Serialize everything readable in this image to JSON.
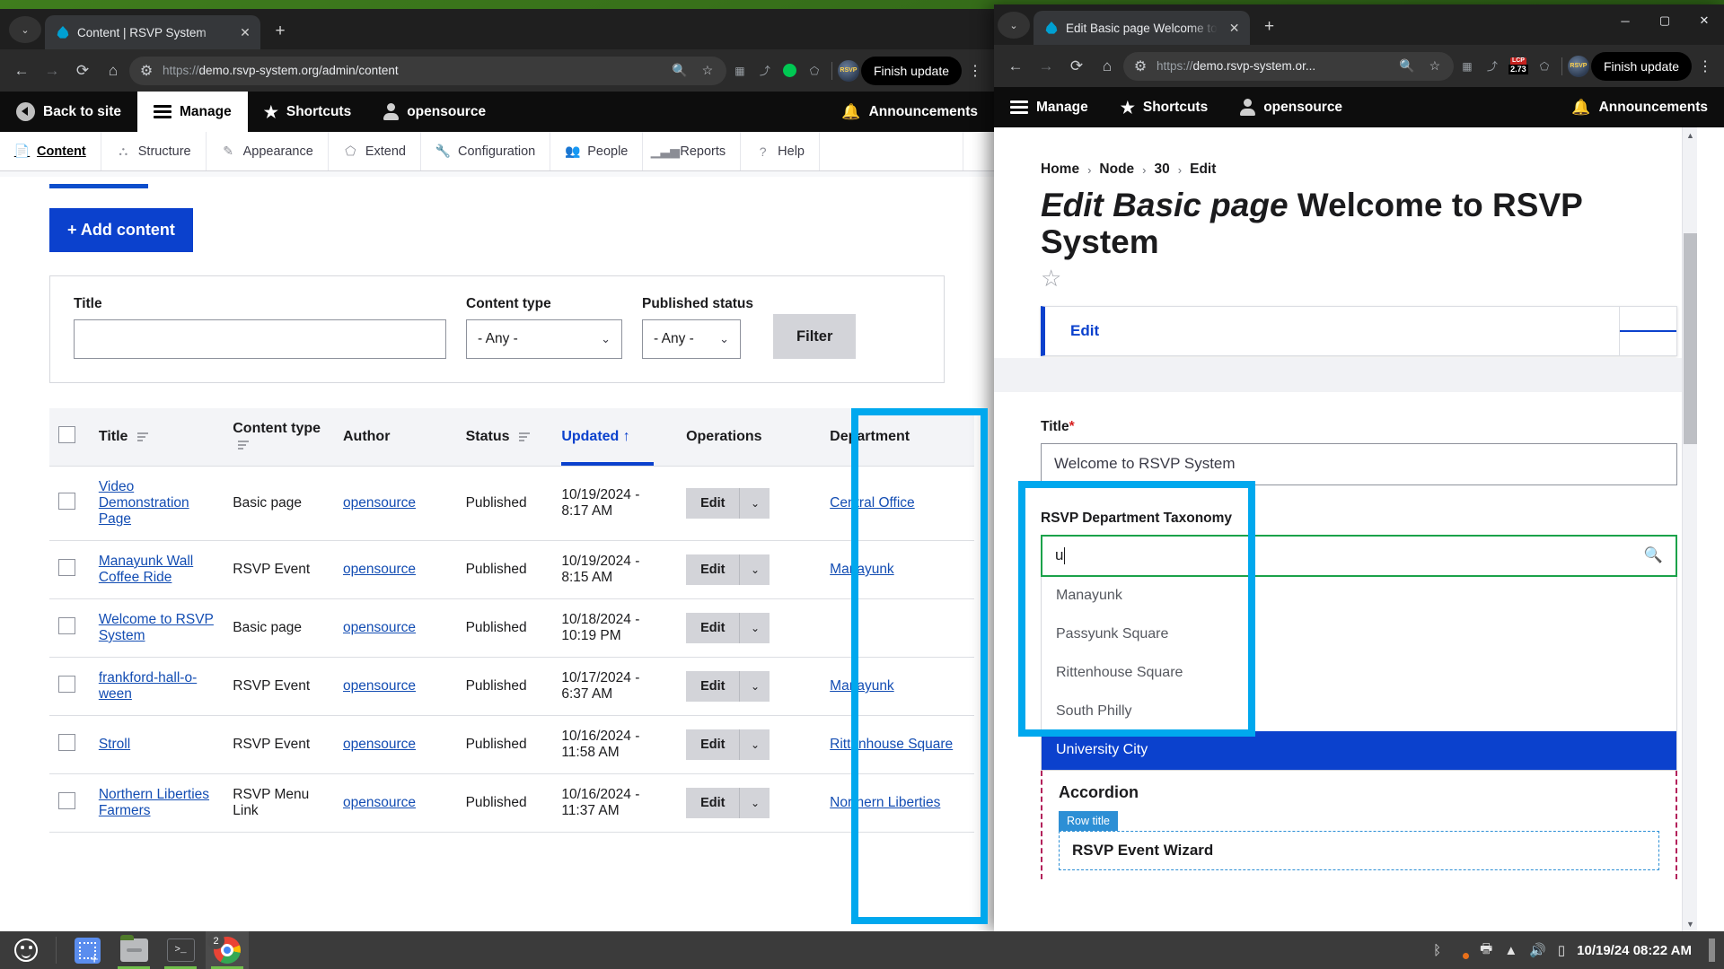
{
  "left_window": {
    "tab": {
      "title": "Content | RSVP System",
      "close_label": "✕"
    },
    "new_tab_label": "+",
    "url": {
      "scheme": "https://",
      "rest": "demo.rsvp-system.org/admin/content"
    },
    "finish_update_label": "Finish update",
    "admin_toolbar": {
      "back_to_site": "Back to site",
      "manage": "Manage",
      "shortcuts": "Shortcuts",
      "user": "opensource",
      "announcements": "Announcements"
    },
    "admin_menu": [
      {
        "label": "Content",
        "icon": "page-icon"
      },
      {
        "label": "Structure",
        "icon": "structure-icon"
      },
      {
        "label": "Appearance",
        "icon": "brush-icon"
      },
      {
        "label": "Extend",
        "icon": "puzzle-icon"
      },
      {
        "label": "Configuration",
        "icon": "wrench-icon"
      },
      {
        "label": "People",
        "icon": "people-icon"
      },
      {
        "label": "Reports",
        "icon": "bars-icon"
      },
      {
        "label": "Help",
        "icon": "question-icon"
      }
    ],
    "add_content_label": "+ Add content",
    "filters": {
      "title_label": "Title",
      "title_value": "",
      "content_type_label": "Content type",
      "content_type_value": "- Any -",
      "published_status_label": "Published status",
      "published_status_value": "- Any -",
      "filter_button": "Filter"
    },
    "table": {
      "headers": [
        "",
        "Title",
        "Content type",
        "Author",
        "Status",
        "Updated",
        "Operations",
        "Department"
      ],
      "sorted_column": "Updated",
      "sort_direction": "↑",
      "edit_label": "Edit",
      "rows": [
        {
          "title": "Video Demonstration Page",
          "type": "Basic page",
          "author": "opensource",
          "status": "Published",
          "updated": "10/19/2024 - 8:17 AM",
          "department": "Central Office"
        },
        {
          "title": "Manayunk Wall Coffee Ride",
          "type": "RSVP Event",
          "author": "opensource",
          "status": "Published",
          "updated": "10/19/2024 - 8:15 AM",
          "department": "Manayunk"
        },
        {
          "title": "Welcome to RSVP System",
          "type": "Basic page",
          "author": "opensource",
          "status": "Published",
          "updated": "10/18/2024 - 10:19 PM",
          "department": ""
        },
        {
          "title": "frankford-hall-o-ween",
          "type": "RSVP Event",
          "author": "opensource",
          "status": "Published",
          "updated": "10/17/2024 - 6:37 AM",
          "department": "Manayunk"
        },
        {
          "title": "Stroll",
          "type": "RSVP Event",
          "author": "opensource",
          "status": "Published",
          "updated": "10/16/2024 - 11:58 AM",
          "department": "Rittenhouse Square"
        },
        {
          "title": "Northern Liberties Farmers",
          "type": "RSVP Menu Link",
          "author": "opensource",
          "status": "Published",
          "updated": "10/16/2024 - 11:37 AM",
          "department": "Northern Liberties"
        }
      ]
    }
  },
  "right_window": {
    "tab": {
      "title": "Edit Basic page Welcome to",
      "close_label": "✕"
    },
    "new_tab_label": "+",
    "url": {
      "scheme": "https://",
      "rest": "demo.rsvp-system.or..."
    },
    "lcp_badge": {
      "top": "LCP",
      "bottom": "2.73"
    },
    "finish_update_label": "Finish update",
    "window_controls": {
      "minimize": "─",
      "maximize": "▢",
      "close": "✕"
    },
    "admin_toolbar": {
      "manage": "Manage",
      "shortcuts": "Shortcuts",
      "user": "opensource",
      "announcements": "Announcements"
    },
    "breadcrumb": [
      "Home",
      "Node",
      "30",
      "Edit"
    ],
    "breadcrumb_separator": "›",
    "page_title_em": "Edit Basic page",
    "page_title_rest": " Welcome to RSVP System",
    "favorite_star": "☆",
    "local_tab": "Edit",
    "form": {
      "title_label": "Title",
      "title_required": "*",
      "title_value": "Welcome to RSVP System",
      "taxonomy_label": "RSVP Department Taxonomy",
      "taxonomy_value": "u",
      "search_icon": "search-icon",
      "autocomplete_options": [
        "Manayunk",
        "Passyunk Square",
        "Rittenhouse Square",
        "South Philly",
        "University City"
      ],
      "autocomplete_selected": "University City"
    },
    "accordion": {
      "title": "Accordion",
      "row_title_badge": "Row title",
      "row_title_value": "RSVP Event Wizard"
    }
  },
  "taskbar": {
    "apps": [
      "screenshot-tool",
      "file-manager",
      "terminal",
      "chrome"
    ],
    "chrome_window_count": "2",
    "clock": "10/19/24 08:22 AM",
    "tray": [
      "bluetooth-icon",
      "shield-icon",
      "printer-icon",
      "wifi-icon",
      "volume-icon",
      "battery-icon"
    ]
  },
  "highlights": {
    "cyan": "#00a8ee",
    "green": "#1ba24a",
    "selected_blue": "#0b41cd"
  }
}
